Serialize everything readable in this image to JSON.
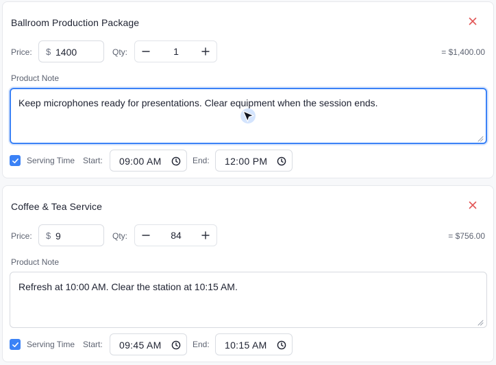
{
  "items": [
    {
      "title": "Ballroom Production Package",
      "price_label": "Price:",
      "currency": "$",
      "price": "1400",
      "qty_label": "Qty:",
      "qty": "1",
      "total": "= $1,400.00",
      "note_label": "Product Note",
      "note": "Keep microphones ready for presentations. Clear equipment when the session ends.",
      "serving_label": "Serving Time",
      "serving_checked": true,
      "start_label": "Start:",
      "start": "09:00 AM",
      "end_label": "End:",
      "end": "12:00 PM"
    },
    {
      "title": "Coffee & Tea Service",
      "price_label": "Price:",
      "currency": "$",
      "price": "9",
      "qty_label": "Qty:",
      "qty": "84",
      "total": "= $756.00",
      "note_label": "Product Note",
      "note": "Refresh at 10:00 AM. Clear the station at 10:15 AM.",
      "serving_label": "Serving Time",
      "serving_checked": true,
      "start_label": "Start:",
      "start": "09:45 AM",
      "end_label": "End:",
      "end": "10:15 AM"
    }
  ],
  "icons": {
    "close": "close-icon",
    "minus": "minus-icon",
    "plus": "plus-icon",
    "check": "checkmark-icon",
    "clock": "clock-icon",
    "cursor": "mouse-pointer-icon"
  },
  "colors": {
    "accent": "#3b82f6",
    "close": "#e25555",
    "border": "#d9dce2",
    "label": "#5c6270"
  }
}
